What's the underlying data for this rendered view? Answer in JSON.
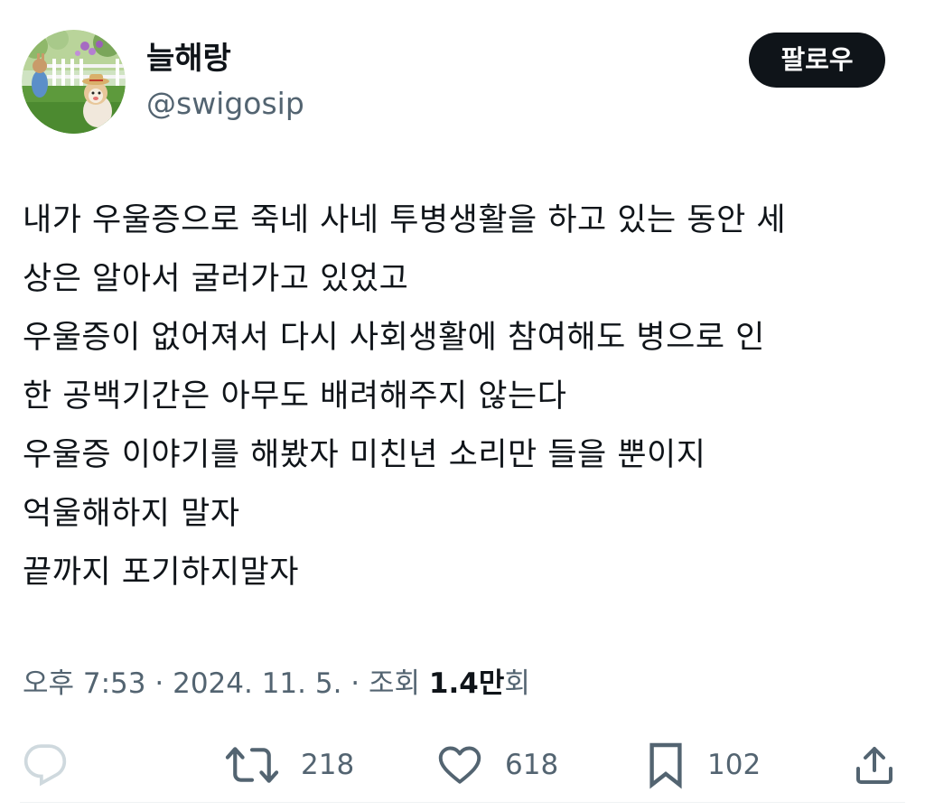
{
  "user": {
    "display_name": "늘해랑",
    "handle": "@swigosip",
    "avatar_icon": "avatar-garden-dog-image"
  },
  "follow_button": {
    "label": "팔로우"
  },
  "tweet": {
    "lines": [
      "내가 우울증으로 죽네 사네 투병생활을 하고 있는 동안 세",
      "상은 알아서 굴러가고 있었고",
      "우울증이 없어져서 다시 사회생활에 참여해도 병으로 인",
      "한 공백기간은 아무도 배려해주지 않는다",
      "우울증 이야기를 해봤자 미친년 소리만 들을 뿐이지",
      "억울해하지 말자",
      "끝까지 포기하지말자"
    ]
  },
  "meta": {
    "time": "오후 7:53",
    "separator": "·",
    "date": "2024. 11. 5.",
    "views_label": "조회",
    "views_count": "1.4",
    "views_unit": "만",
    "views_suffix": "회"
  },
  "actions": {
    "reply": {
      "icon": "reply-icon",
      "count": ""
    },
    "retweet": {
      "icon": "retweet-icon",
      "count": "218"
    },
    "like": {
      "icon": "heart-icon",
      "count": "618"
    },
    "bookmark": {
      "icon": "bookmark-icon",
      "count": "102"
    },
    "share": {
      "icon": "share-icon",
      "count": ""
    }
  },
  "colors": {
    "text_primary": "#0f1419",
    "text_secondary": "#536471",
    "reply_icon_muted": "#cfd9de",
    "follow_bg": "#0f1419",
    "follow_text": "#ffffff"
  }
}
